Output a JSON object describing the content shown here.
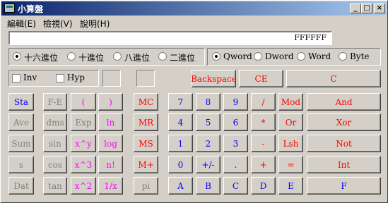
{
  "window": {
    "title": "小算盤",
    "minimize_label": "_",
    "maximize_label": "□",
    "close_label": "×"
  },
  "menu": [
    "編輯(E)",
    "檢視(V)",
    "說明(H)"
  ],
  "display": {
    "value": "FFFFFF"
  },
  "base_options": [
    {
      "label": "十六進位",
      "selected": true
    },
    {
      "label": "十進位",
      "selected": false
    },
    {
      "label": "八進位",
      "selected": false
    },
    {
      "label": "二進位",
      "selected": false
    }
  ],
  "word_options": [
    {
      "label": "Qword",
      "selected": true
    },
    {
      "label": "Dword",
      "selected": false
    },
    {
      "label": "Word",
      "selected": false
    },
    {
      "label": "Byte",
      "selected": false
    }
  ],
  "checkboxes": {
    "inv": "Inv",
    "hyp": "Hyp"
  },
  "top_buttons": {
    "backspace": "Backspace",
    "ce": "CE",
    "c": "C"
  },
  "stat_buttons": [
    "Sta",
    "Ave",
    "Sum",
    "s",
    "Dat"
  ],
  "sci_col1": [
    "F-E",
    "dms",
    "sin",
    "cos",
    "tan"
  ],
  "sci_col2": [
    "(",
    "Exp",
    "x^y",
    "x^3",
    "x^2"
  ],
  "sci_col3": [
    ")",
    "ln",
    "log",
    "n!",
    "1/x"
  ],
  "mem_buttons": [
    "MC",
    "MR",
    "MS",
    "M+",
    "pi"
  ],
  "num_rows": [
    [
      "7",
      "8",
      "9",
      "/",
      "Mod",
      "And"
    ],
    [
      "4",
      "5",
      "6",
      "*",
      "Or",
      "Xor"
    ],
    [
      "1",
      "2",
      "3",
      "-",
      "Lsh",
      "Not"
    ],
    [
      "0",
      "+/-",
      ".",
      "+",
      "=",
      "Int"
    ],
    [
      "A",
      "B",
      "C",
      "D",
      "E",
      "F"
    ]
  ],
  "colors": {
    "blue": "#0000ff",
    "red": "#ff0000",
    "magenta": "#ff00ff",
    "gray": "#808080",
    "face": "#d4d0c8"
  }
}
